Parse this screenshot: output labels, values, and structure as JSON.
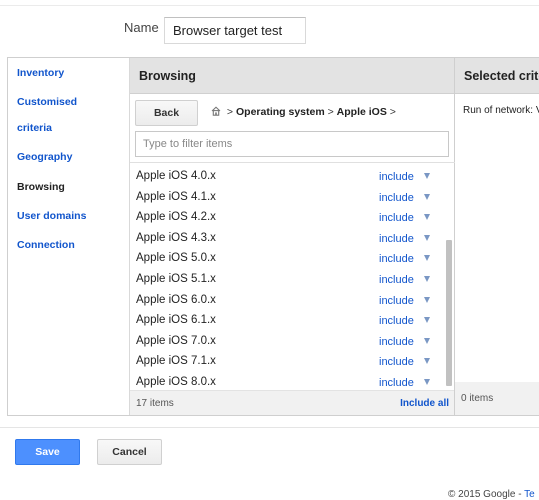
{
  "form": {
    "name_label": "Name",
    "name_value": "Browser target test"
  },
  "nav": {
    "items": [
      {
        "label": "Inventory",
        "active": false
      },
      {
        "label": "Customised",
        "active": false
      },
      {
        "label": "criteria",
        "active": false
      },
      {
        "label": "Geography",
        "active": false
      },
      {
        "label": "Browsing",
        "active": true
      },
      {
        "label": "User domains",
        "active": false
      },
      {
        "label": "Connection",
        "active": false
      }
    ]
  },
  "browsing": {
    "title": "Browsing",
    "back_label": "Back",
    "breadcrumb": {
      "sep1": ">",
      "crumb1": "Operating system",
      "sep2": ">",
      "crumb2": "Apple iOS",
      "sep3": ">"
    },
    "filter_placeholder": "Type to filter items",
    "include_label": "include",
    "items": [
      "Apple iOS 4.0.x",
      "Apple iOS 4.1.x",
      "Apple iOS 4.2.x",
      "Apple iOS 4.3.x",
      "Apple iOS 5.0.x",
      "Apple iOS 5.1.x",
      "Apple iOS 6.0.x",
      "Apple iOS 6.1.x",
      "Apple iOS 7.0.x",
      "Apple iOS 7.1.x",
      "Apple iOS 8.0.x"
    ],
    "count_label": "17 items",
    "include_all_label": "Include all"
  },
  "selected": {
    "title": "Selected crite",
    "item": "Run of network: V",
    "count_label": "0 items"
  },
  "actions": {
    "save_label": "Save",
    "cancel_label": "Cancel"
  },
  "footer": {
    "copyright": "© 2015 Google - ",
    "link": "Te"
  },
  "colors": {
    "accent": "#1155cc",
    "primary_button": "#4d90fe",
    "header_bg": "#e3e3e3"
  }
}
